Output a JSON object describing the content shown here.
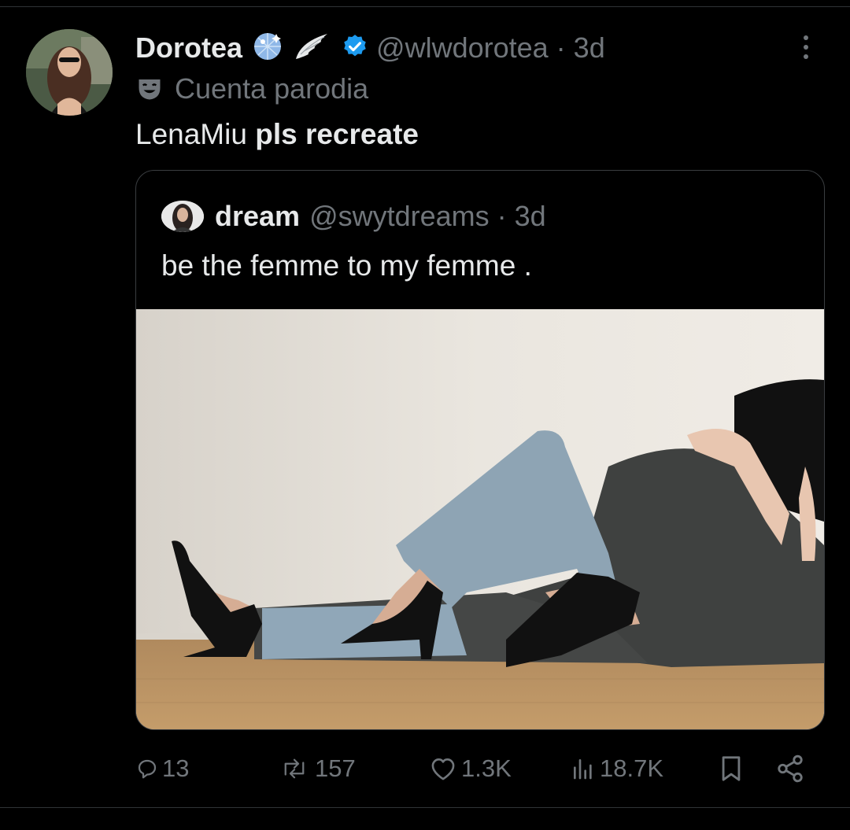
{
  "author": {
    "display_name": "Dorotea",
    "emojis": [
      "disco-ball-emoji",
      "wing-emoji"
    ],
    "verified": true,
    "handle": "@wlwdorotea",
    "separator": "·",
    "time": "3d",
    "label": "Cuenta parodia"
  },
  "tweet": {
    "text_plain": "LenaMiu ",
    "text_bold": "pls recreate"
  },
  "quoted": {
    "display_name": "dream",
    "handle": "@swytdreams",
    "separator": "·",
    "time": "3d",
    "text": "be the femme to my femme  ."
  },
  "actions": {
    "replies": "13",
    "reposts": "157",
    "likes": "1.3K",
    "views": "18.7K"
  },
  "colors": {
    "background": "#000000",
    "text": "#e7e9ea",
    "secondary": "#71767b",
    "verified": "#1d9bf0",
    "border": "#2f3336"
  }
}
